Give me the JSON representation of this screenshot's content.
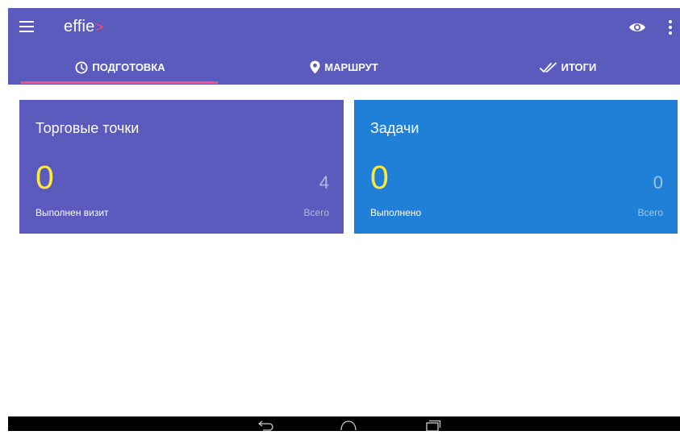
{
  "app": {
    "logo_text": "effie",
    "logo_mark": ">"
  },
  "icons": {
    "menu": "menu-icon",
    "eye": "eye-icon",
    "more": "more-vert-icon",
    "clock": "clock-icon",
    "location": "location-pin-icon",
    "double_check": "double-check-icon"
  },
  "tabs": [
    {
      "label": "ПОДГОТОВКА",
      "icon": "clock-icon",
      "active": true
    },
    {
      "label": "МАРШРУТ",
      "icon": "location-pin-icon",
      "active": false
    },
    {
      "label": "ИТОГИ",
      "icon": "double-check-icon",
      "active": false
    }
  ],
  "cards": {
    "outlets": {
      "title": "Торговые точки",
      "done_value": "0",
      "done_label": "Выполнен визит",
      "total_value": "4",
      "total_label": "Всего"
    },
    "tasks": {
      "title": "Задачи",
      "done_value": "0",
      "done_label": "Выполнено",
      "total_value": "0",
      "total_label": "Всего"
    }
  },
  "colors": {
    "primary": "#5b5bbd",
    "tasks_card": "#2080d8",
    "accent_indicator": "#ff4f81",
    "highlight_value": "#ffea3b",
    "logo_mark": "#ff4f6d"
  }
}
